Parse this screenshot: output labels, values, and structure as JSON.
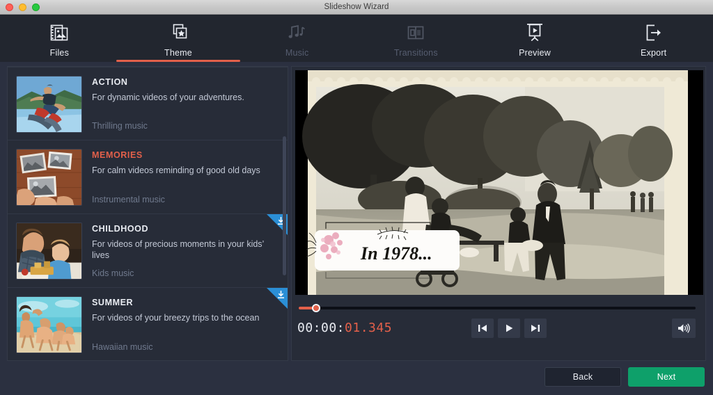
{
  "window": {
    "title": "Slideshow Wizard",
    "controls": {
      "close": "close-button",
      "minimize": "minimize-button",
      "maximize": "maximize-button"
    }
  },
  "tabs": [
    {
      "label": "Files",
      "icon": "photo-stack-icon",
      "state": "enabled",
      "active": false
    },
    {
      "label": "Theme",
      "icon": "star-layers-icon",
      "state": "enabled",
      "active": true
    },
    {
      "label": "Music",
      "icon": "music-notes-icon",
      "state": "disabled",
      "active": false
    },
    {
      "label": "Transitions",
      "icon": "transition-icon",
      "state": "disabled",
      "active": false
    },
    {
      "label": "Preview",
      "icon": "presentation-play-icon",
      "state": "enabled",
      "active": false
    },
    {
      "label": "Export",
      "icon": "export-arrow-icon",
      "state": "enabled",
      "active": false
    }
  ],
  "themes": [
    {
      "name": "ACTION",
      "description": "For dynamic videos of your adventures.",
      "music": "Thrilling music",
      "selected": false,
      "downloadable": false,
      "thumbnail": "wakeboarder-jumping-on-lake"
    },
    {
      "name": "MEMORIES",
      "description": "For calm videos reminding of good old days",
      "music": "Instrumental music",
      "selected": true,
      "downloadable": false,
      "thumbnail": "old-photos-on-wooden-table"
    },
    {
      "name": "CHILDHOOD",
      "description": "For videos of precious moments in your kids’ lives",
      "music": "Kids music",
      "selected": false,
      "downloadable": true,
      "thumbnail": "father-and-toddler-playing"
    },
    {
      "name": "SUMMER",
      "description": "For videos of your breezy trips to the ocean",
      "music": "Hawaiian music",
      "selected": false,
      "downloadable": true,
      "thumbnail": "kids-running-on-beach"
    }
  ],
  "preview": {
    "caption_overlay": "In 1978...",
    "image_description": "vintage-black-and-white-family-photo-in-park",
    "timecode_prefix": "00:00:",
    "timecode_value": "01.345",
    "progress_percent": 4,
    "transport": [
      {
        "label": "Previous",
        "icon": "skip-previous-icon"
      },
      {
        "label": "Play",
        "icon": "play-icon"
      },
      {
        "label": "Next",
        "icon": "skip-next-icon"
      }
    ],
    "volume": {
      "label": "Volume",
      "icon": "speaker-on-icon"
    }
  },
  "footer": {
    "back_label": "Back",
    "next_label": "Next"
  },
  "colors": {
    "accent_red": "#e3604a",
    "accent_green": "#0ea06a",
    "badge_blue": "#2b8fd6",
    "panel_bg": "#272c38",
    "app_bg": "#2b3040",
    "tabbar_bg": "#22262f"
  }
}
